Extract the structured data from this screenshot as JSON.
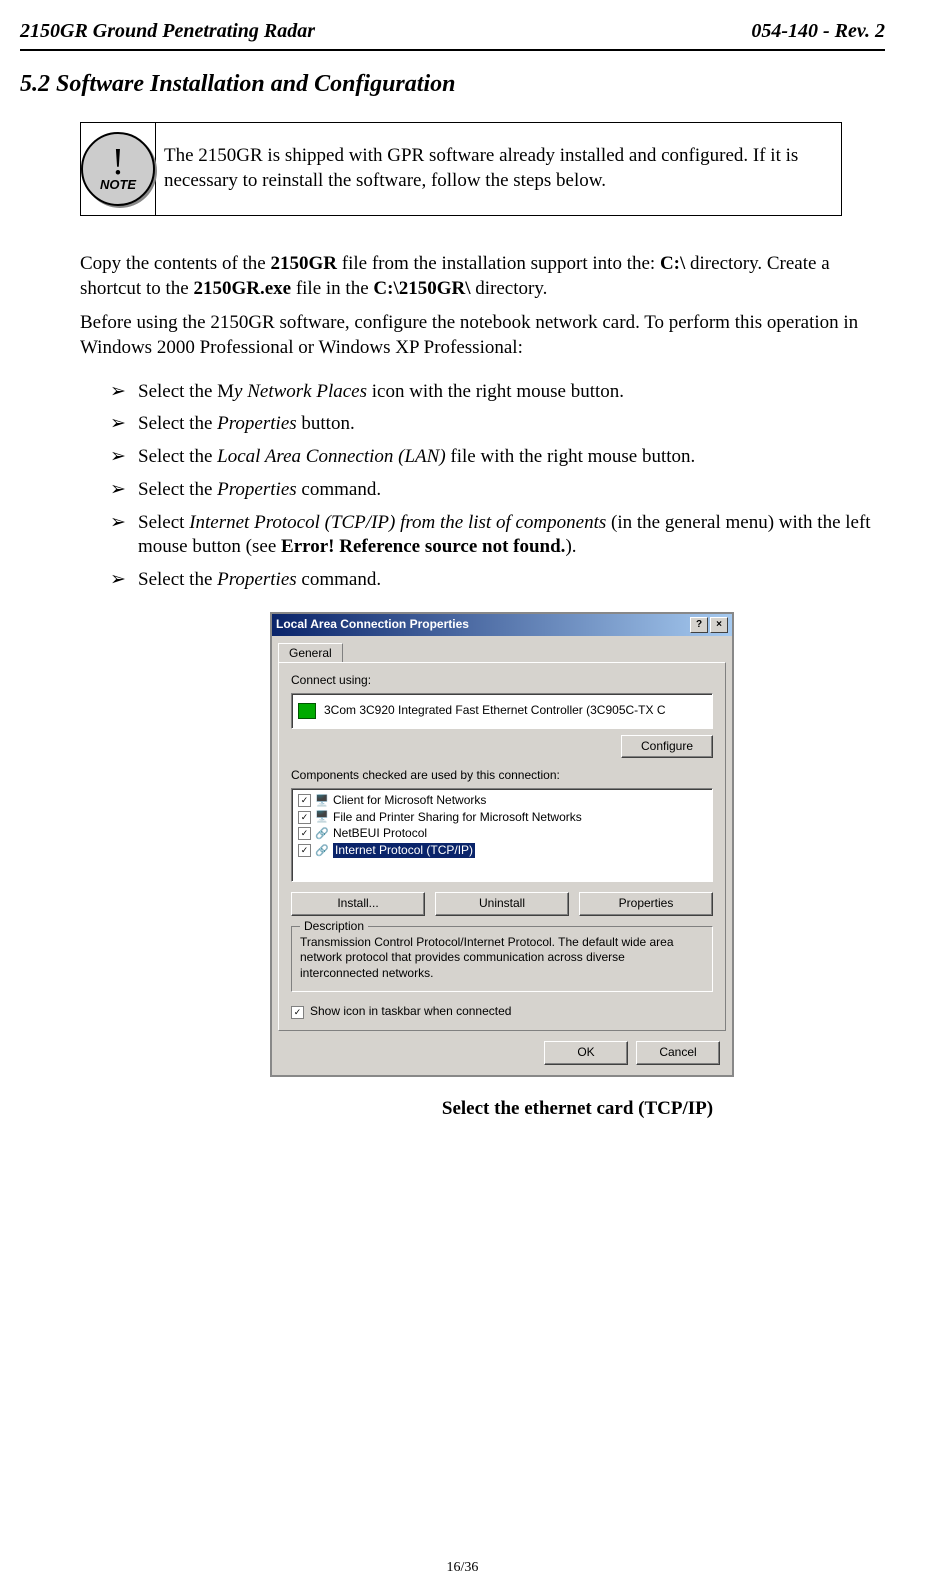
{
  "header": {
    "left": "2150GR Ground Penetrating Radar",
    "right": "054-140 - Rev. 2"
  },
  "section_title": "5.2 Software Installation and Configuration",
  "note": {
    "bang": "!",
    "label": "NOTE",
    "text": "The 2150GR is shipped with GPR software already installed and configured. If it is necessary to reinstall the software, follow the steps below."
  },
  "para1": {
    "t1": "Copy the contents of the ",
    "b1": "2150GR",
    "t2": " file from the installation support into the: ",
    "b2": "C:\\",
    "t3": " directory. Create a shortcut to the ",
    "b3": "2150GR.exe",
    "t4": " file in the ",
    "b4": "C:\\2150GR\\",
    "t5": " directory."
  },
  "para2": "Before using the 2150GR software, configure the notebook network card. To perform this operation in Windows 2000 Professional or Windows XP Professional:",
  "bullets": {
    "b1a": "Select the M",
    "b1i": "y Network Places",
    "b1b": " icon with the right mouse button.",
    "b2a": "Select the ",
    "b2i": "Properties",
    "b2b": " button.",
    "b3a": "Select the ",
    "b3i": "Local Area Connection (LAN)",
    "b3b": " file with the right mouse button.",
    "b4a": "Select the ",
    "b4i": "Properties",
    "b4b": " command.",
    "b5a": "Select ",
    "b5i": "Internet Protocol (TCP/IP) from the list of components",
    "b5b": " (in the general menu) with the left mouse button (see ",
    "b5bold": "Error! Reference source not found.",
    "b5c": ").",
    "b6a": "Select the ",
    "b6i": "Properties",
    "b6b": " command."
  },
  "dialog": {
    "title": "Local Area Connection Properties",
    "help": "?",
    "close": "×",
    "tab": "General",
    "connect_label": "Connect using:",
    "nic": "3Com 3C920 Integrated Fast Ethernet Controller (3C905C-TX C",
    "configure": "Configure",
    "components_label": "Components checked are used by this connection:",
    "items": [
      {
        "label": "Client for Microsoft Networks",
        "icon": "🖥️"
      },
      {
        "label": "File and Printer Sharing for Microsoft Networks",
        "icon": "🖥️"
      },
      {
        "label": "NetBEUI Protocol",
        "icon": "🔗"
      },
      {
        "label": "Internet Protocol (TCP/IP)",
        "icon": "🔗"
      }
    ],
    "install": "Install...",
    "uninstall": "Uninstall",
    "properties": "Properties",
    "desc_legend": "Description",
    "desc_text": "Transmission Control Protocol/Internet Protocol. The default wide area network protocol that provides communication across diverse interconnected networks.",
    "show_icon": "Show icon in taskbar when connected",
    "ok": "OK",
    "cancel": "Cancel",
    "check": "✓"
  },
  "caption": "Select the ethernet card (TCP/IP)",
  "footer": "16/36"
}
